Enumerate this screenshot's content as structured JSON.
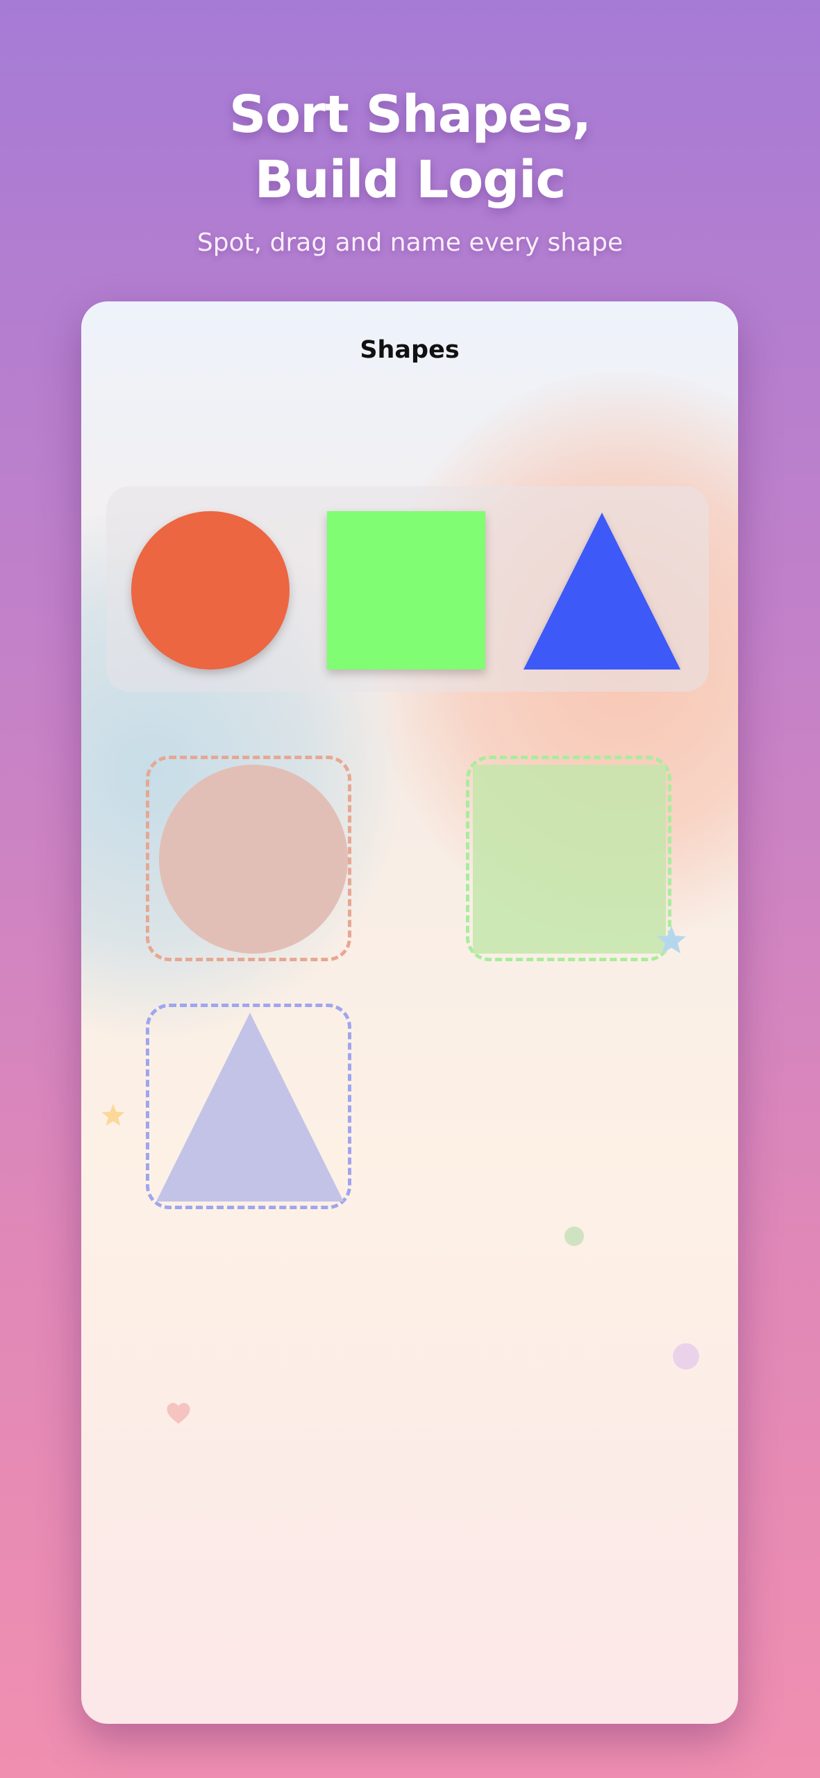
{
  "header": {
    "headline": "Sort Shapes,\nBuild Logic",
    "subheadline": "Spot, drag and name every shape"
  },
  "card": {
    "title": "Shapes"
  },
  "shapes": [
    {
      "name": "circle",
      "color": "#ec6642"
    },
    {
      "name": "square",
      "color": "#80fd72"
    },
    {
      "name": "triangle",
      "color": "#3d5af8"
    }
  ],
  "drop_zones": [
    {
      "shape": "circle",
      "border_color": "#e7a792",
      "ghost_color": "#e2bfb6"
    },
    {
      "shape": "square",
      "border_color": "#a6ee9c",
      "ghost_color": "#c4e6ac"
    },
    {
      "shape": "triangle",
      "border_color": "#9fa5ee",
      "ghost_color": "#c3c3e8"
    }
  ],
  "decorations": [
    "star-icon",
    "star-icon",
    "dot",
    "dot",
    "heart-icon"
  ],
  "theme": {
    "background_top": "#a67bd6",
    "background_bottom": "#f08fb0"
  }
}
